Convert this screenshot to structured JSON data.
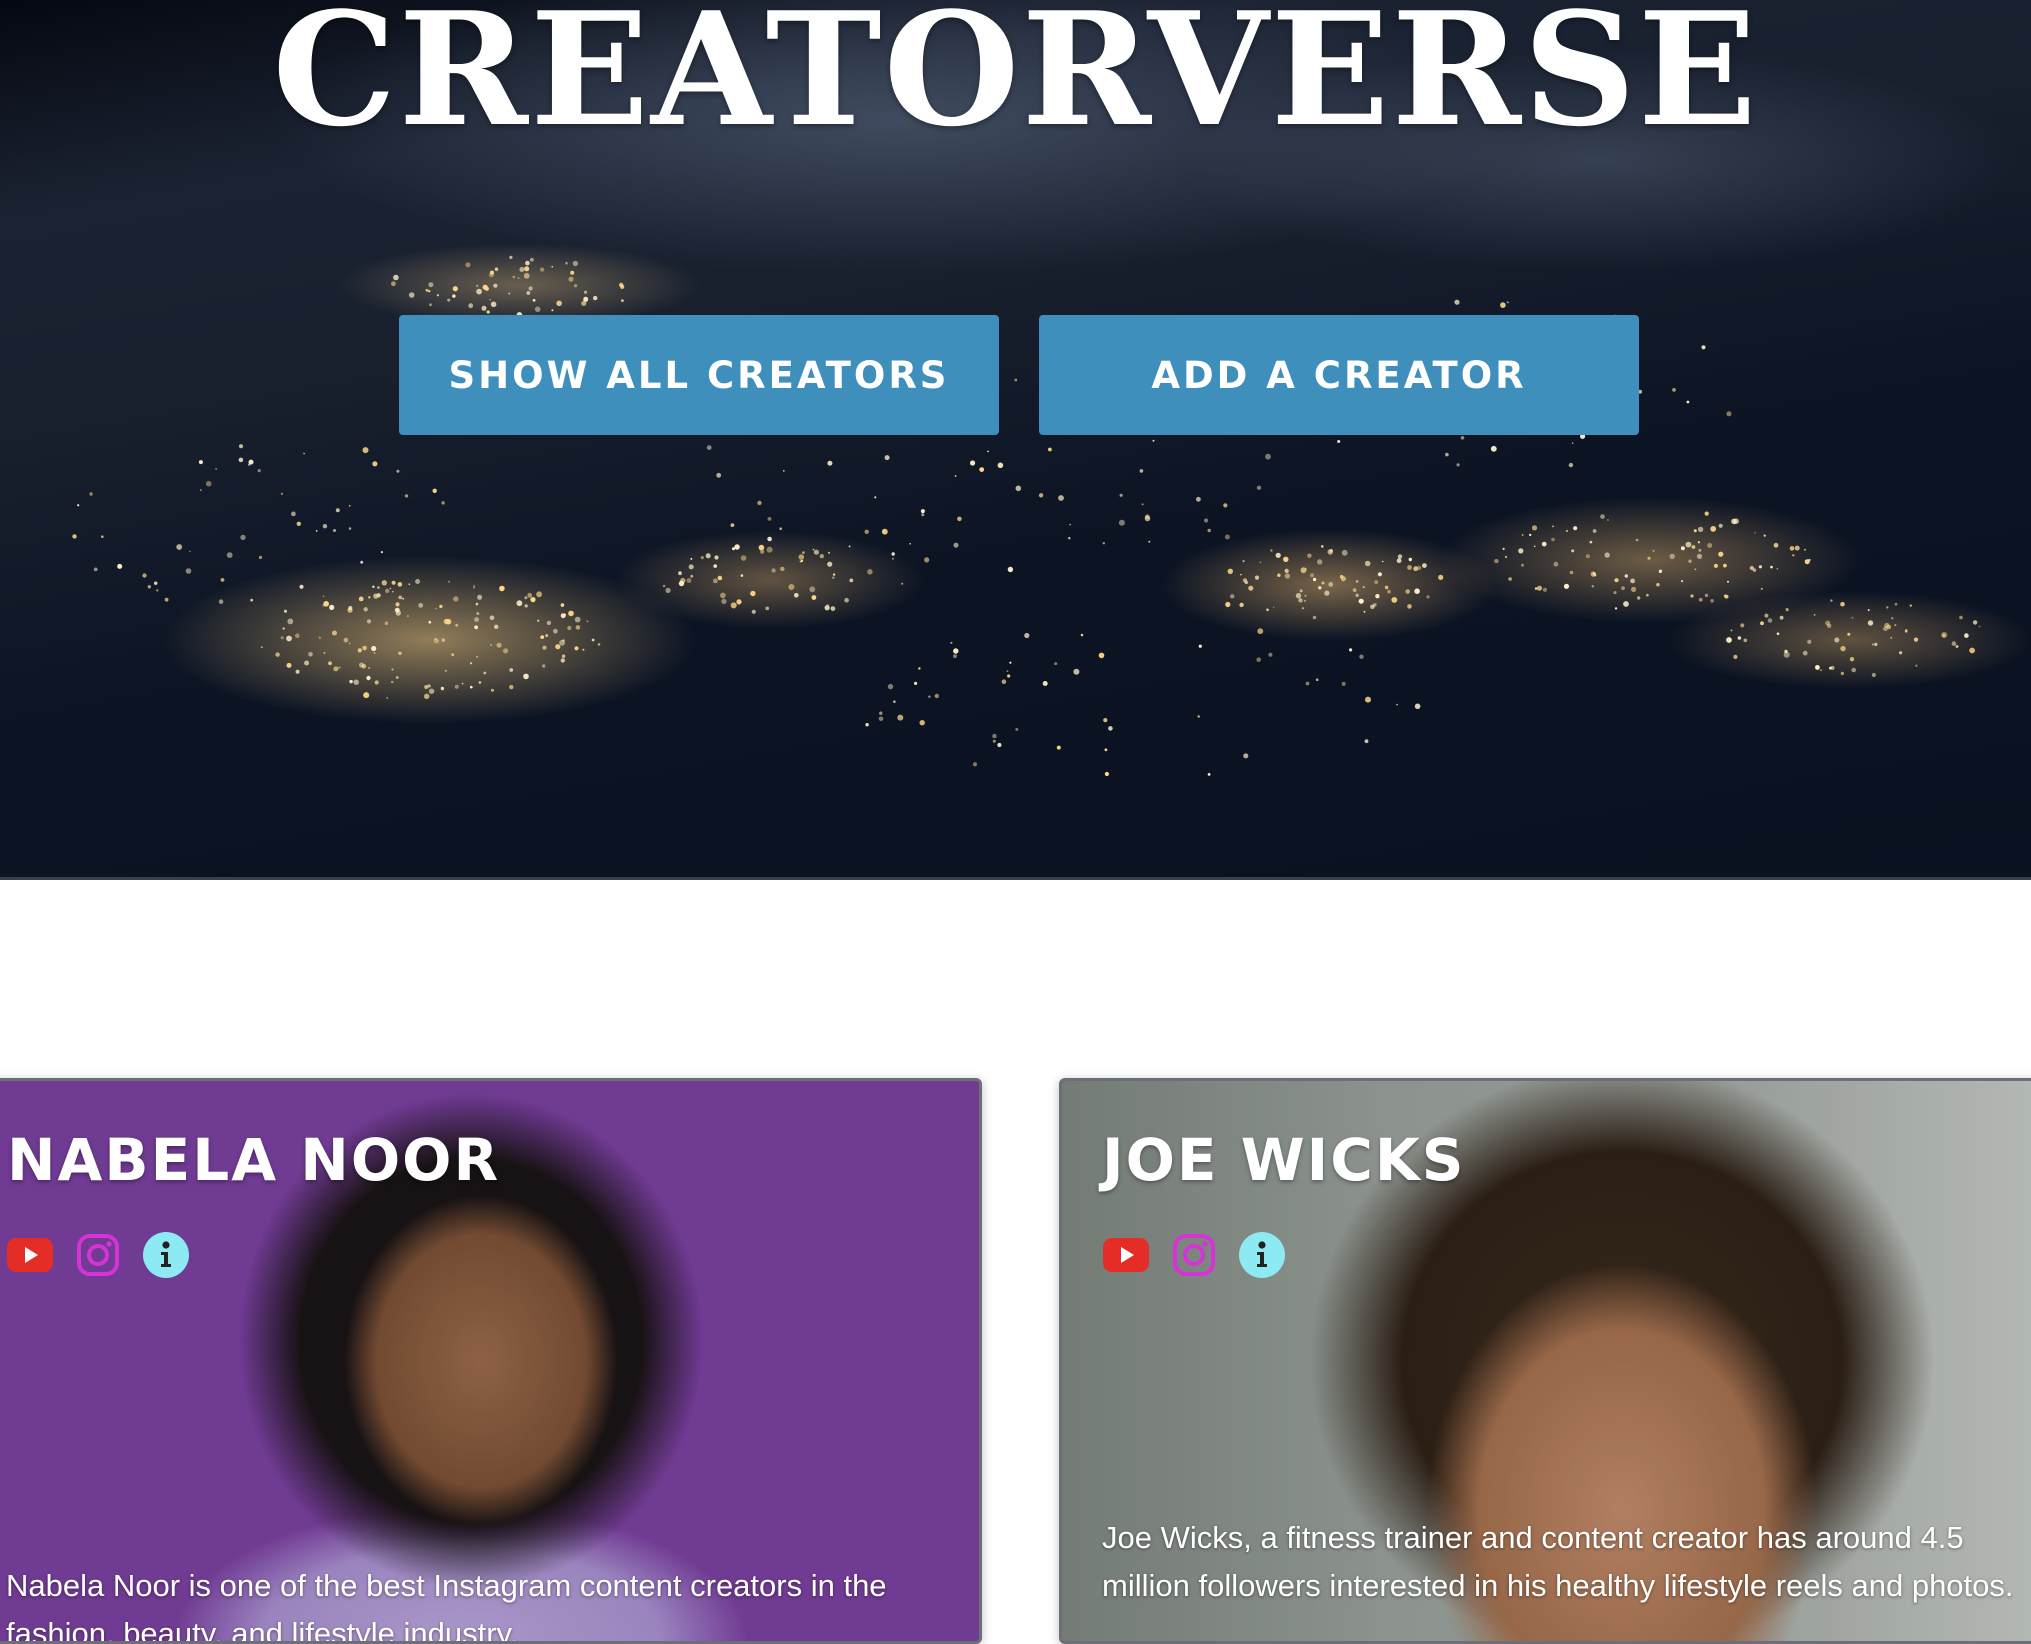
{
  "hero": {
    "title": "CREATORVERSE",
    "buttons": {
      "show_all": "SHOW ALL CREATORS",
      "add": "ADD A CREATOR"
    },
    "button_color": "#3f8fbd"
  },
  "creators": [
    {
      "name": "NABELA NOOR",
      "description": "Nabela Noor is one of the best Instagram content creators in the fashion, beauty, and lifestyle industry.",
      "icons": [
        "youtube-icon",
        "instagram-icon",
        "info-icon"
      ]
    },
    {
      "name": "JOE WICKS",
      "description": "Joe Wicks, a fitness trainer and content creator has around 4.5 million followers interested in his healthy lifestyle reels and photos.",
      "icons": [
        "youtube-icon",
        "instagram-icon",
        "info-icon"
      ]
    }
  ],
  "colors": {
    "youtube": "#e52d27",
    "instagram": "#d633d6",
    "info": "#8eeaf2"
  }
}
